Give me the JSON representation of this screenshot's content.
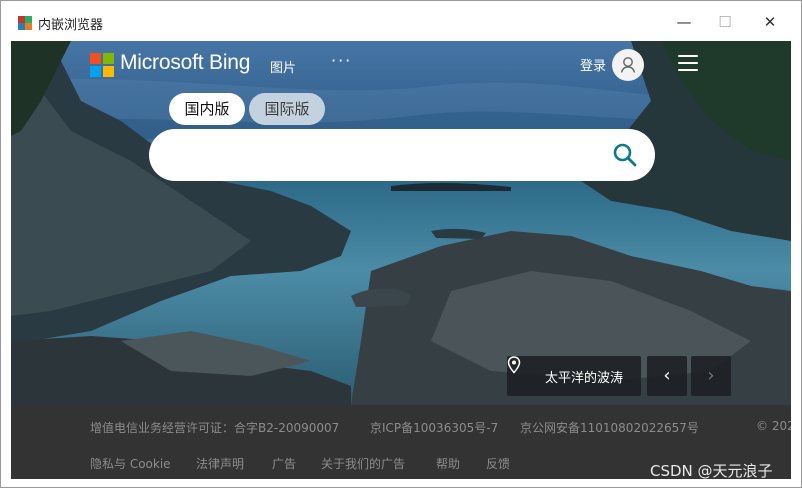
{
  "window": {
    "title": "内嵌浏览器",
    "minimize_glyph": "—",
    "maximize_glyph": "☐",
    "close_glyph": "✕"
  },
  "header": {
    "brand": "Microsoft Bing",
    "nav": [
      "图片"
    ],
    "more": "···",
    "login": "登录"
  },
  "tabs": {
    "domestic": "国内版",
    "international": "国际版"
  },
  "search": {
    "placeholder": "",
    "value": ""
  },
  "image_info": {
    "location": "太平洋的波涛",
    "prev_glyph": "‹",
    "next_glyph": "›"
  },
  "footer": {
    "row1": {
      "license": "增值电信业务经营许可证：合字B2-20090007",
      "icp": "京ICP备10036305号-7",
      "police": "京公网安备11010802022657号",
      "copyright": "© 202"
    },
    "row2": [
      "隐私与 Cookie",
      "法律声明",
      "广告",
      "关于我们的广告",
      "帮助",
      "反馈"
    ]
  },
  "watermark": "CSDN @天元浪子",
  "colors": {
    "bing_red": "#f25022",
    "bing_green": "#7fba00",
    "bing_blue": "#00a4ef",
    "bing_yellow": "#ffb900",
    "search_icon": "#0c7a8e",
    "footer_bg": "#333333",
    "footer_text": "#8c8c8c"
  }
}
